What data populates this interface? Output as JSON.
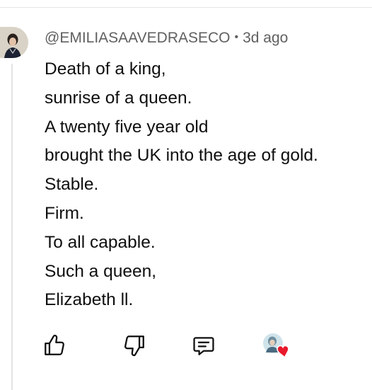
{
  "comment": {
    "author": "@EMILIASAAVEDRASECO",
    "separator": "•",
    "timestamp": "3d ago",
    "lines": [
      "Death of a king,",
      "sunrise of a queen.",
      "A twenty five year old",
      "brought the UK into the age of gold.",
      "Stable.",
      "Firm.",
      "To all capable.",
      "Such a queen,",
      "Elizabeth ll."
    ]
  },
  "actions": {
    "like_icon": "thumb-up-icon",
    "dislike_icon": "thumb-down-icon",
    "reply_icon": "reply-comment-icon",
    "hearted_icon": "creator-heart-icon"
  },
  "colors": {
    "text_primary": "#0f0f0f",
    "text_secondary": "#606060",
    "heart": "#e8192c",
    "divider": "#e5e5e5"
  }
}
